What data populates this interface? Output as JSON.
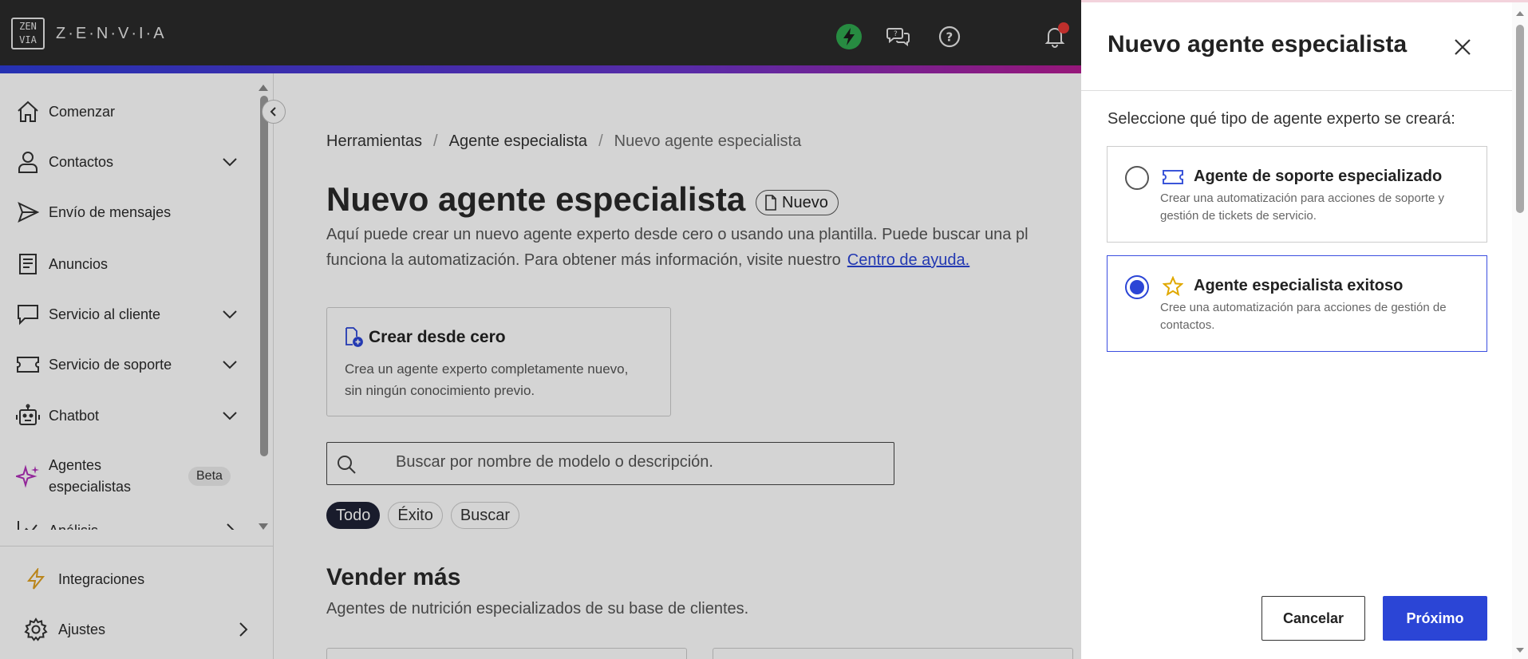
{
  "brand": {
    "logo_mark": "ZEN VIA",
    "name": "Z·E·N·V·I·A"
  },
  "topbar": {
    "icons": [
      "lightning-icon",
      "chat-help-icon",
      "help-icon",
      "bell-icon"
    ]
  },
  "sidebar": {
    "items": [
      {
        "label": "Comenzar",
        "icon": "home-icon",
        "chevron": ""
      },
      {
        "label": "Contactos",
        "icon": "person-icon",
        "chevron": "down"
      },
      {
        "label": "Envío de mensajes",
        "icon": "send-icon",
        "chevron": ""
      },
      {
        "label": "Anuncios",
        "icon": "document-icon",
        "chevron": ""
      },
      {
        "label": "Servicio al cliente",
        "icon": "speech-bubble-icon",
        "chevron": "down"
      },
      {
        "label": "Servicio de soporte",
        "icon": "ticket-icon",
        "chevron": "down"
      },
      {
        "label": "Chatbot",
        "icon": "robot-icon",
        "chevron": "down"
      },
      {
        "label": "Agentes\nespecialistas",
        "icon": "sparkle-icon",
        "badge": "Beta"
      },
      {
        "label": "Análisis",
        "icon": "chart-icon",
        "chevron": "right"
      }
    ],
    "bottom": [
      {
        "label": "Integraciones",
        "icon": "lightning-icon"
      },
      {
        "label": "Ajustes",
        "icon": "gear-icon",
        "chevron": "right"
      }
    ]
  },
  "main": {
    "breadcrumb": [
      "Herramientas",
      "Agente especialista",
      "Nuevo agente especialista"
    ],
    "title": "Nuevo agente especialista",
    "badge": "Nuevo",
    "description_line1": "Aquí puede crear un nuevo agente experto desde cero o usando una plantilla. Puede buscar una pl",
    "description_line2": "funciona la automatización. Para obtener más información, visite nuestro",
    "help_link": "Centro de ayuda.",
    "create_card": {
      "title": "Crear desde cero",
      "description": "Crea un agente experto completamente nuevo, sin ningún conocimiento previo."
    },
    "search_placeholder": "Buscar por nombre de modelo o descripción.",
    "filters": [
      {
        "label": "Todo",
        "active": true
      },
      {
        "label": "Éxito",
        "active": false
      },
      {
        "label": "Buscar",
        "active": false
      }
    ],
    "section_title": "Vender más",
    "section_subtitle": "Agentes de nutrición especializados de su base de clientes."
  },
  "drawer": {
    "title": "Nuevo agente especialista",
    "prompt": "Seleccione qué tipo de agente experto se creará:",
    "options": [
      {
        "title": "Agente de soporte especializado",
        "description": "Crear una automatización para acciones de soporte y gestión de tickets de servicio.",
        "icon": "ticket-icon",
        "selected": false
      },
      {
        "title": "Agente especialista exitoso",
        "description": "Cree una automatización para acciones de gestión de contactos.",
        "icon": "star-icon",
        "selected": true
      }
    ],
    "cancel_label": "Cancelar",
    "next_label": "Próximo"
  },
  "colors": {
    "accent": "#2b45d6",
    "topbar": "#2b2b2b",
    "lightning_green": "#2fa84f",
    "star": "#e0a800"
  }
}
